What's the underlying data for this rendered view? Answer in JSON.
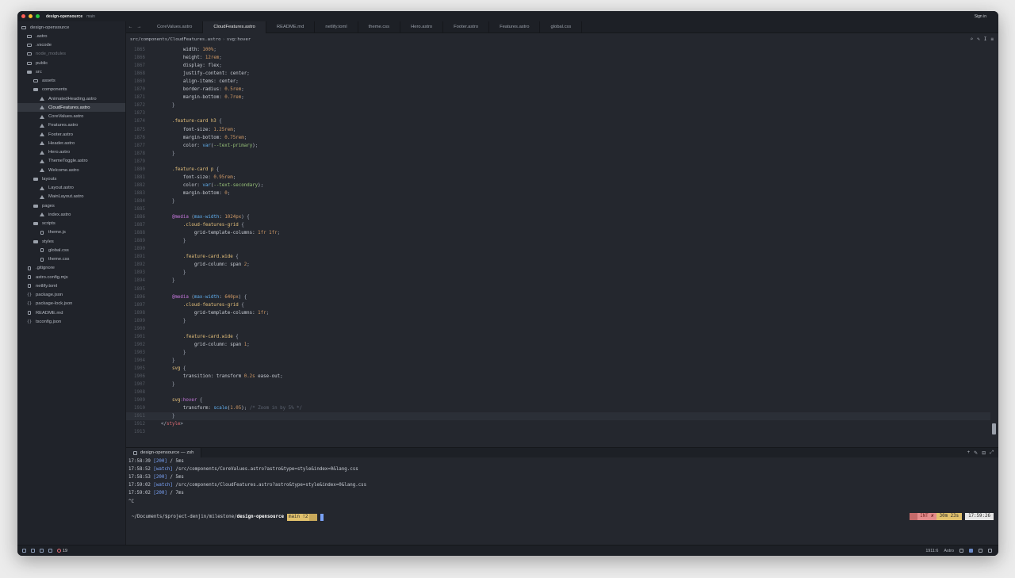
{
  "titlebar": {
    "project": "design-opensource",
    "branch": "main",
    "signin": "Sign in",
    "colors": {
      "close": "#ff5f57",
      "minimize": "#febc2e",
      "maximize": "#28c840"
    }
  },
  "sidebar": {
    "items": [
      {
        "label": "design-opensource",
        "icon": "project-icon",
        "depth": 0,
        "kind": "root"
      },
      {
        "label": ".astro",
        "icon": "folder-icon",
        "depth": 1,
        "kind": "folder"
      },
      {
        "label": ".vscode",
        "icon": "folder-icon",
        "depth": 1,
        "kind": "folder"
      },
      {
        "label": "node_modules",
        "icon": "folder-icon",
        "depth": 1,
        "kind": "folder",
        "dim": true
      },
      {
        "label": "public",
        "icon": "folder-icon",
        "depth": 1,
        "kind": "folder"
      },
      {
        "label": "src",
        "icon": "folder-open-icon",
        "depth": 1,
        "kind": "folder-open"
      },
      {
        "label": "assets",
        "icon": "folder-icon",
        "depth": 2,
        "kind": "folder"
      },
      {
        "label": "components",
        "icon": "folder-open-icon",
        "depth": 2,
        "kind": "folder-open"
      },
      {
        "label": "AnimatedHeading.astro",
        "icon": "astro-file-icon",
        "depth": 3,
        "kind": "astro"
      },
      {
        "label": "CloudFeatures.astro",
        "icon": "astro-file-icon",
        "depth": 3,
        "kind": "astro",
        "selected": true
      },
      {
        "label": "CoreValues.astro",
        "icon": "astro-file-icon",
        "depth": 3,
        "kind": "astro"
      },
      {
        "label": "Features.astro",
        "icon": "astro-file-icon",
        "depth": 3,
        "kind": "astro"
      },
      {
        "label": "Footer.astro",
        "icon": "astro-file-icon",
        "depth": 3,
        "kind": "astro"
      },
      {
        "label": "Header.astro",
        "icon": "astro-file-icon",
        "depth": 3,
        "kind": "astro"
      },
      {
        "label": "Hero.astro",
        "icon": "astro-file-icon",
        "depth": 3,
        "kind": "astro"
      },
      {
        "label": "ThemeToggle.astro",
        "icon": "astro-file-icon",
        "depth": 3,
        "kind": "astro"
      },
      {
        "label": "Welcome.astro",
        "icon": "astro-file-icon",
        "depth": 3,
        "kind": "astro"
      },
      {
        "label": "layouts",
        "icon": "folder-open-icon",
        "depth": 2,
        "kind": "folder-open"
      },
      {
        "label": "Layout.astro",
        "icon": "astro-file-icon",
        "depth": 3,
        "kind": "astro"
      },
      {
        "label": "MainLayout.astro",
        "icon": "astro-file-icon",
        "depth": 3,
        "kind": "astro"
      },
      {
        "label": "pages",
        "icon": "folder-open-icon",
        "depth": 2,
        "kind": "folder-open"
      },
      {
        "label": "index.astro",
        "icon": "astro-file-icon",
        "depth": 3,
        "kind": "astro"
      },
      {
        "label": "scripts",
        "icon": "folder-open-icon",
        "depth": 2,
        "kind": "folder-open"
      },
      {
        "label": "theme.js",
        "icon": "js-file-icon",
        "depth": 3,
        "kind": "file"
      },
      {
        "label": "styles",
        "icon": "folder-open-icon",
        "depth": 2,
        "kind": "folder-open"
      },
      {
        "label": "global.css",
        "icon": "css-file-icon",
        "depth": 3,
        "kind": "file"
      },
      {
        "label": "theme.css",
        "icon": "css-file-icon",
        "depth": 3,
        "kind": "file"
      },
      {
        "label": ".gitignore",
        "icon": "git-icon",
        "depth": 1,
        "kind": "file"
      },
      {
        "label": "astro.config.mjs",
        "icon": "config-file-icon",
        "depth": 1,
        "kind": "file"
      },
      {
        "label": "netlify.toml",
        "icon": "toml-file-icon",
        "depth": 1,
        "kind": "file"
      },
      {
        "label": "package.json",
        "icon": "json-file-icon",
        "depth": 1,
        "kind": "json"
      },
      {
        "label": "package-lock.json",
        "icon": "json-file-icon",
        "depth": 1,
        "kind": "json"
      },
      {
        "label": "README.md",
        "icon": "markdown-file-icon",
        "depth": 1,
        "kind": "file"
      },
      {
        "label": "tsconfig.json",
        "icon": "json-file-icon",
        "depth": 1,
        "kind": "json"
      }
    ]
  },
  "tabs": [
    {
      "label": "CoreValues.astro"
    },
    {
      "label": "CloudFeatures.astro",
      "active": true
    },
    {
      "label": "README.md"
    },
    {
      "label": "netlify.toml"
    },
    {
      "label": "theme.css"
    },
    {
      "label": "Hero.astro"
    },
    {
      "label": "Footer.astro"
    },
    {
      "label": "Features.astro"
    },
    {
      "label": "global.css"
    }
  ],
  "breadcrumb": {
    "path": "src/components/CloudFeatures.astro",
    "separator": "›",
    "symbol": "svg:hover"
  },
  "editor": {
    "current_line": 1911,
    "lines": [
      {
        "n": "1865",
        "text": "          width: 100%;"
      },
      {
        "n": "1866",
        "text": "          height: 12rem;"
      },
      {
        "n": "1867",
        "text": "          display: flex;"
      },
      {
        "n": "1868",
        "text": "          justify-content: center;"
      },
      {
        "n": "1869",
        "text": "          align-items: center;"
      },
      {
        "n": "1870",
        "text": "          border-radius: 0.5rem;"
      },
      {
        "n": "1871",
        "text": "          margin-bottom: 0.7rem;"
      },
      {
        "n": "1872",
        "text": "      }"
      },
      {
        "n": "1873",
        "text": ""
      },
      {
        "n": "1874",
        "text": "      .feature-card h3 {"
      },
      {
        "n": "1875",
        "text": "          font-size: 1.25rem;"
      },
      {
        "n": "1876",
        "text": "          margin-bottom: 0.75rem;"
      },
      {
        "n": "1877",
        "text": "          color: var(--text-primary);"
      },
      {
        "n": "1878",
        "text": "      }"
      },
      {
        "n": "1879",
        "text": ""
      },
      {
        "n": "1880",
        "text": "      .feature-card p {"
      },
      {
        "n": "1881",
        "text": "          font-size: 0.95rem;"
      },
      {
        "n": "1882",
        "text": "          color: var(--text-secondary);"
      },
      {
        "n": "1883",
        "text": "          margin-bottom: 0;"
      },
      {
        "n": "1884",
        "text": "      }"
      },
      {
        "n": "1885",
        "text": ""
      },
      {
        "n": "1886",
        "text": "      @media (max-width: 1024px) {"
      },
      {
        "n": "1887",
        "text": "          .cloud-features-grid {"
      },
      {
        "n": "1888",
        "text": "              grid-template-columns: 1fr 1fr;"
      },
      {
        "n": "1889",
        "text": "          }"
      },
      {
        "n": "1890",
        "text": ""
      },
      {
        "n": "1891",
        "text": "          .feature-card.wide {"
      },
      {
        "n": "1892",
        "text": "              grid-column: span 2;"
      },
      {
        "n": "1893",
        "text": "          }"
      },
      {
        "n": "1894",
        "text": "      }"
      },
      {
        "n": "1895",
        "text": ""
      },
      {
        "n": "1896",
        "text": "      @media (max-width: 640px) {"
      },
      {
        "n": "1897",
        "text": "          .cloud-features-grid {"
      },
      {
        "n": "1898",
        "text": "              grid-template-columns: 1fr;"
      },
      {
        "n": "1899",
        "text": "          }"
      },
      {
        "n": "1900",
        "text": ""
      },
      {
        "n": "1901",
        "text": "          .feature-card.wide {"
      },
      {
        "n": "1902",
        "text": "              grid-column: span 1;"
      },
      {
        "n": "1903",
        "text": "          }"
      },
      {
        "n": "1904",
        "text": "      }"
      },
      {
        "n": "1905",
        "text": "      svg {"
      },
      {
        "n": "1906",
        "text": "          transition: transform 0.2s ease-out;"
      },
      {
        "n": "1907",
        "text": "      }"
      },
      {
        "n": "1908",
        "text": ""
      },
      {
        "n": "1909",
        "text": "      svg:hover {"
      },
      {
        "n": "1910",
        "text": "          transform: scale(1.05); /* Zoom in by 5% */"
      },
      {
        "n": "1911",
        "text": "      }"
      },
      {
        "n": "1912",
        "text": "  </style>"
      },
      {
        "n": "1913",
        "text": ""
      }
    ]
  },
  "terminal": {
    "tab_label": "design-opensource — zsh",
    "lines": [
      {
        "time": "17:58:39",
        "tag": "[200]",
        "rest": " / 5ms"
      },
      {
        "time": "17:58:52",
        "tag": "[watch]",
        "rest": " /src/components/CoreValues.astro?astro&type=style&index=0&lang.css"
      },
      {
        "time": "17:58:53",
        "tag": "[200]",
        "rest": " / 5ms"
      },
      {
        "time": "17:59:02",
        "tag": "[watch]",
        "rest": " /src/components/CloudFeatures.astro?astro&type=style&index=0&lang.css"
      },
      {
        "time": "17:59:02",
        "tag": "[200]",
        "rest": " / 7ms"
      },
      {
        "time": "",
        "tag": "",
        "rest": "^C"
      }
    ],
    "prompt_path": "~/Documents/$project-denjin/milestone/",
    "prompt_dir": "design-opensource",
    "git_status": "main !2",
    "right_int": "INT ✘",
    "right_duration": "30m 23s",
    "right_time": "17:59:26"
  },
  "statusbar": {
    "errors": "19",
    "position": "1911:6",
    "language": "Astro"
  }
}
